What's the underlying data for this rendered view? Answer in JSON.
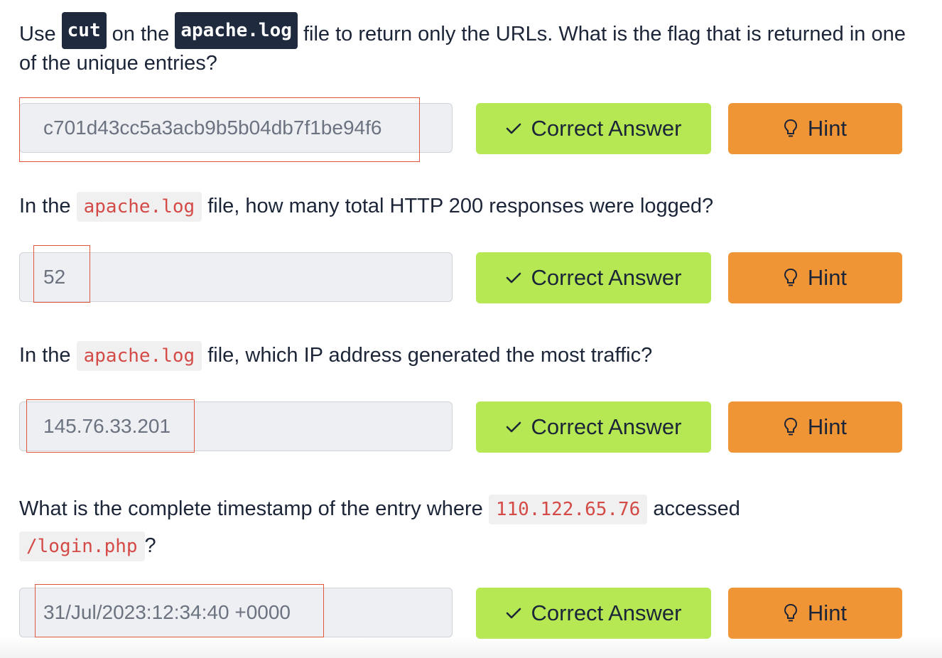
{
  "questions": [
    {
      "parts": {
        "t1": "Use ",
        "c1": "cut",
        "t2": " on the ",
        "c2": "apache.log",
        "t3": " file to return only the URLs. What is the flag that is returned in one of the unique entries?"
      },
      "answer": "c701d43cc5a3acb9b5b04db7f1be94f6"
    },
    {
      "parts": {
        "t1": "In the ",
        "c1": "apache.log",
        "t2": " file, how many total HTTP 200 responses were logged?"
      },
      "answer": "52"
    },
    {
      "parts": {
        "t1": "In the ",
        "c1": "apache.log",
        "t2": " file, which IP address generated the most traffic?"
      },
      "answer": "145.76.33.201"
    },
    {
      "parts": {
        "t1": "What is the complete timestamp of the entry where ",
        "c1": "110.122.65.76",
        "t2": " accessed",
        "c2": "/login.php",
        "t3": "?"
      },
      "answer": "31/Jul/2023:12:34:40 +0000"
    }
  ],
  "buttons": {
    "correct_label": "Correct Answer",
    "hint_label": "Hint"
  },
  "icons": {
    "check": "check-icon",
    "hint": "lightbulb-icon"
  },
  "colors": {
    "correct_bg": "#b5e853",
    "hint_bg": "#f09535",
    "code_dark_bg": "#1f2a3e",
    "code_light_fg": "#d44a47",
    "highlight_border": "#e0563e"
  }
}
